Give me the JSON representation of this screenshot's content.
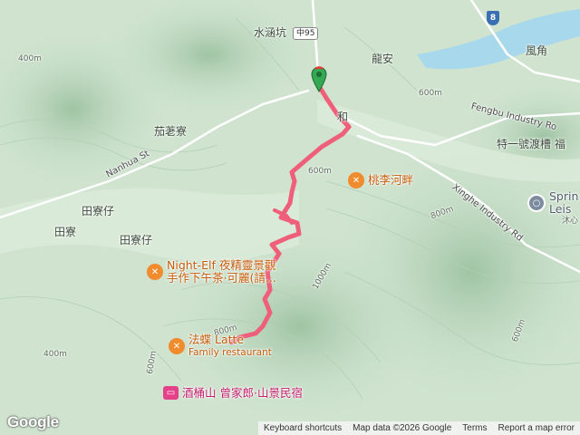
{
  "map": {
    "route_color": "#ef5f7a",
    "marker_color": "#34a853",
    "water_color": "#a8d8ec"
  },
  "places": {
    "shuihankeng": "水涵坑",
    "longan": "龍安",
    "fengjiao": "風角",
    "jiaoliliao": "茄荖寮",
    "tianliaozai_1": "田寮仔",
    "tianliao": "田寮",
    "tianliaozai_2": "田寮仔",
    "he_partial": "和",
    "tea_partial": "特一號渡槽 福",
    "xinxin": "沐心"
  },
  "roads": {
    "route_zhong95": "中95",
    "highway_8": "8",
    "fengbu_rd": "Fengbu Industry Ro",
    "xinghe_rd": "Xinghe Industry Rd",
    "nanhua_st": "Nanhua St"
  },
  "contours": {
    "c600_a": "600m",
    "c600_b": "600m",
    "c800_a": "800m",
    "c800_b": "800m",
    "c1000": "1000m",
    "c400": "400m",
    "c600_c": "600m",
    "c600_d": "600m",
    "c400_b": "400m"
  },
  "pois": {
    "taoli": "桃李河畔",
    "nightelf_line1": "Night-Elf 夜精靈景觀",
    "nightelf_line2": "手作下午茶·可麗(請...",
    "fadie_line1": "法蝶 Latte",
    "fadie_line2": "Family restaurant",
    "jiutong": "酒桶山 曾家郎·山景民宿",
    "spring_line1": "Sprin",
    "spring_line2": "Leis"
  },
  "footer": {
    "shortcuts": "Keyboard shortcuts",
    "mapdata": "Map data ©2026 Google",
    "terms": "Terms",
    "report": "Report a map error"
  },
  "logo": "Google"
}
